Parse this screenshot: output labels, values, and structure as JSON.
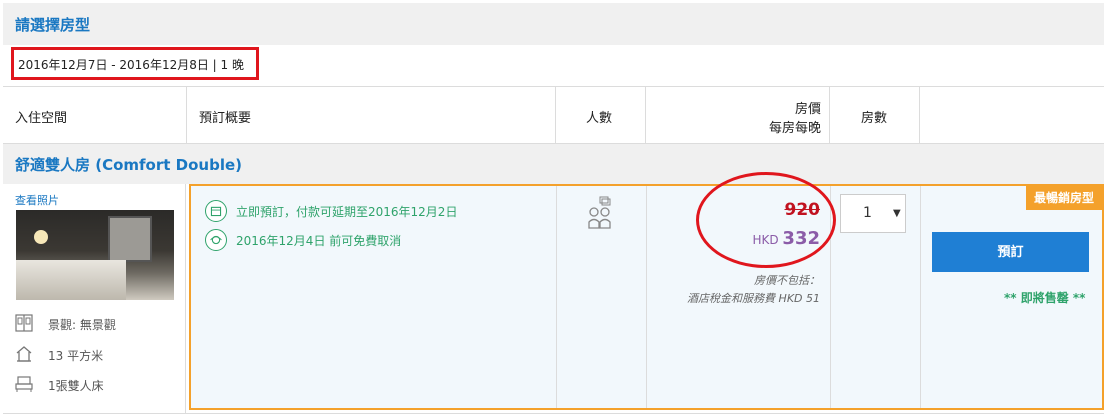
{
  "header": {
    "title": "請選擇房型"
  },
  "stay": {
    "dates": "2016年12月7日 - 2016年12月8日 | 1 晚"
  },
  "columns": {
    "arrival": "入住空間",
    "summary": "預訂概要",
    "guests": "人數",
    "price_line1": "房價",
    "price_line2": "每房每晚",
    "rooms": "房數"
  },
  "room": {
    "name": "舒適雙人房 (Comfort Double)",
    "photo_link": "查看照片",
    "features": [
      {
        "icon": "window-icon",
        "text": "景觀: 無景觀"
      },
      {
        "icon": "house-icon",
        "text": "13 平方米"
      },
      {
        "icon": "bed-icon",
        "text": "1張雙人床"
      }
    ],
    "policies": [
      {
        "icon": "calendar-icon",
        "text": "立即預訂，付款可延期至2016年12月2日"
      },
      {
        "icon": "refund-icon",
        "text": "2016年12月4日 前可免費取消"
      }
    ],
    "price_original": "920",
    "price_currency": "HKD",
    "price_now": "332",
    "tax_line1": "房價不包括：",
    "tax_line2": "酒店稅金和服務費 HKD 51",
    "room_count_selected": "1",
    "badge": "最暢銷房型",
    "book_label": "預訂",
    "urgency": "** 即將售罄 **"
  },
  "colors": {
    "accent_blue": "#1a78c2",
    "book_button": "#1f7fd4",
    "badge_orange": "#f4a12b",
    "policy_green": "#2fa36b",
    "price_red": "#c1121f",
    "price_purple": "#8b5ca8",
    "annotation_red": "#e0161d"
  }
}
